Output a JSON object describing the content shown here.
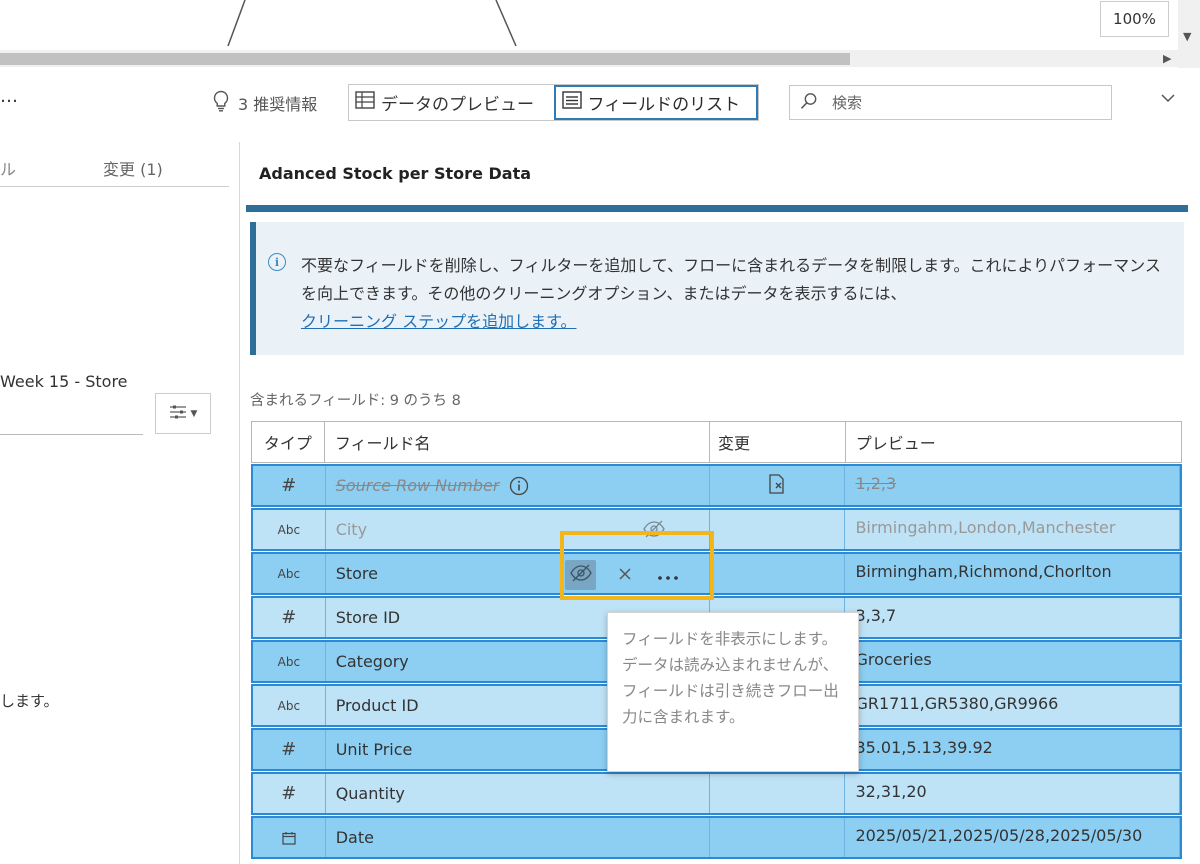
{
  "canvas": {
    "zoom_label": "100%"
  },
  "toolbar": {
    "recommendations_label": "3 推奨情報",
    "preview_tab_label": "データのプレビュー",
    "field_list_tab_label": "フィールドのリスト",
    "search_placeholder": "検索"
  },
  "left_panel": {
    "tab_partial_label": "ル",
    "tab_changes_label": "変更 (1)",
    "step_name_partial": "Week 15 - Store",
    "partial_text": "します。"
  },
  "main": {
    "title": "Adanced Stock per Store Data",
    "info_text_prefix": "不要なフィールドを削除し、フィルターを追加して、フローに含まれるデータを制限します。これによりパフォーマンスを向上できます。その他のクリーニングオプション、またはデータを表示するには、",
    "info_link": "クリーニング ステップを追加します。",
    "field_count_label": "含まれるフィールド: 9 のうち 8"
  },
  "table": {
    "headers": {
      "type": "タイプ",
      "name": "フィールド名",
      "change": "変更",
      "preview": "プレビュー"
    },
    "rows": [
      {
        "type": "#",
        "name": "Source Row Number",
        "preview": "1,2,3",
        "state": "removed"
      },
      {
        "type": "Abc",
        "name": "City",
        "preview": "Birmingahm,London,Manchester",
        "state": "hidden"
      },
      {
        "type": "Abc",
        "name": "Store",
        "preview": "Birmingham,Richmond,Chorlton",
        "state": "selected"
      },
      {
        "type": "#",
        "name": "Store ID",
        "preview": "3,3,7",
        "state": "normal"
      },
      {
        "type": "Abc",
        "name": "Category",
        "preview": "Groceries",
        "state": "normal"
      },
      {
        "type": "Abc",
        "name": "Product ID",
        "preview": "GR1711,GR5380,GR9966",
        "state": "normal"
      },
      {
        "type": "#",
        "name": "Unit Price",
        "preview": "35.01,5.13,39.92",
        "state": "normal"
      },
      {
        "type": "#",
        "name": "Quantity",
        "preview": "32,31,20",
        "state": "normal"
      },
      {
        "type": "date",
        "name": "Date",
        "preview": "2025/05/21,2025/05/28,2025/05/30",
        "state": "normal"
      }
    ]
  },
  "tooltip": {
    "text": "フィールドを非表示にします。データは読み込まれませんが、フィールドは引き続きフロー出力に含まれます。"
  },
  "colors": {
    "accent": "#2e6f99",
    "row_light": "#bfe3f6",
    "row_dark": "#8dcff3",
    "row_border": "#2b8ad6",
    "highlight": "#f2b51a",
    "link": "#1f6fb5"
  },
  "icons": {
    "recommendations": "lightbulb-icon",
    "preview_tab": "table-grid-icon",
    "field_list_tab": "list-icon",
    "search": "search-icon",
    "collapse": "chevron-down-icon",
    "filter": "filter-sliders-icon",
    "info": "info-icon",
    "hide": "eye-slash-icon",
    "remove": "close-icon",
    "more": "more-icon",
    "removed_change": "document-remove-icon"
  }
}
